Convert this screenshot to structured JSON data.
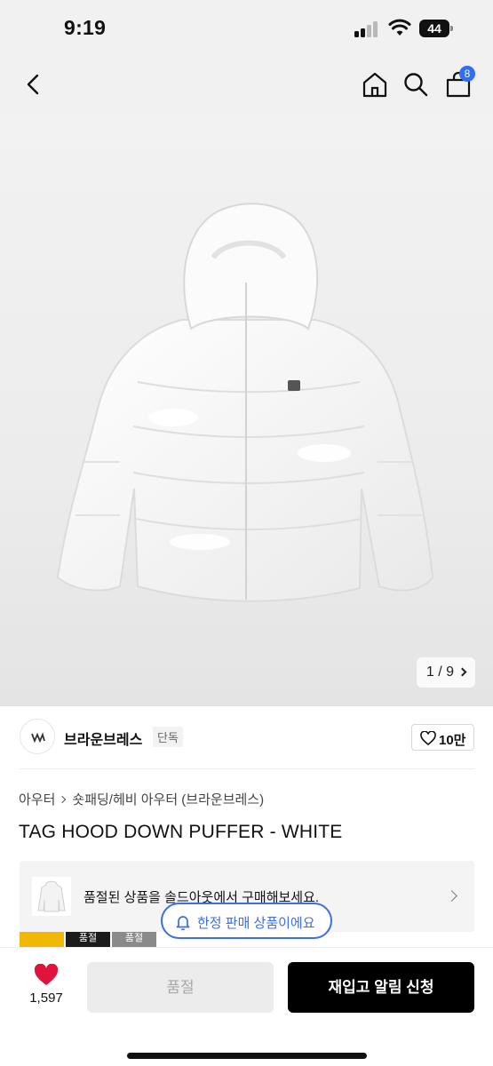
{
  "status_bar": {
    "time": "9:19",
    "battery": "44"
  },
  "nav": {
    "cart_count": "8"
  },
  "gallery": {
    "current": 1,
    "total": 9,
    "pager_label": "1 / 9"
  },
  "brand": {
    "name": "브라운브레스",
    "tag": "단독",
    "likes": "10만"
  },
  "breadcrumb": {
    "level1": "아우터",
    "level2": "숏패딩/헤비 아우터 (브라운브레스)"
  },
  "product": {
    "title": "TAG HOOD DOWN PUFFER - WHITE"
  },
  "soldout_banner": {
    "text": "품절된 상품을 솔드아웃에서 구매해보세요."
  },
  "limited_pill": {
    "text": "한정 판매 상품이에요"
  },
  "swatches": [
    "",
    "품절",
    "품절"
  ],
  "bottom": {
    "wish_count": "1,597",
    "soldout_label": "품절",
    "restock_label": "재입고 알림 신청"
  },
  "colors": {
    "accent": "#3e6de9",
    "badge": "#2f6ef5",
    "heart": "#e1123c"
  }
}
